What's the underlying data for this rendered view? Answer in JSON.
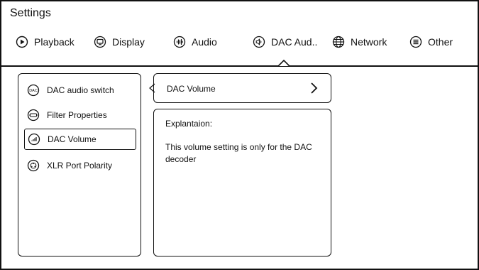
{
  "app": {
    "title": "Settings"
  },
  "tabs": [
    {
      "label": "Playback",
      "icon": "play-circle-icon"
    },
    {
      "label": "Display",
      "icon": "monitor-icon"
    },
    {
      "label": "Audio",
      "icon": "audio-wave-icon"
    },
    {
      "label": "DAC Aud..",
      "icon": "speaker-icon",
      "selected": true
    },
    {
      "label": "Network",
      "icon": "globe-icon"
    },
    {
      "label": "Other",
      "icon": "menu-circle-icon"
    }
  ],
  "menu": {
    "items": [
      {
        "label": "DAC audio switch",
        "icon": "dac-icon"
      },
      {
        "label": "Filter Properties",
        "icon": "filter-icon"
      },
      {
        "label": "DAC Volume",
        "icon": "volume-bars-icon",
        "active": true
      },
      {
        "label": "XLR Port Polarity",
        "icon": "polarity-icon"
      }
    ]
  },
  "detail": {
    "option_label": "DAC Volume",
    "explanation_heading": "Explantaion:",
    "explanation_text": "This volume setting is only for the DAC decoder"
  }
}
